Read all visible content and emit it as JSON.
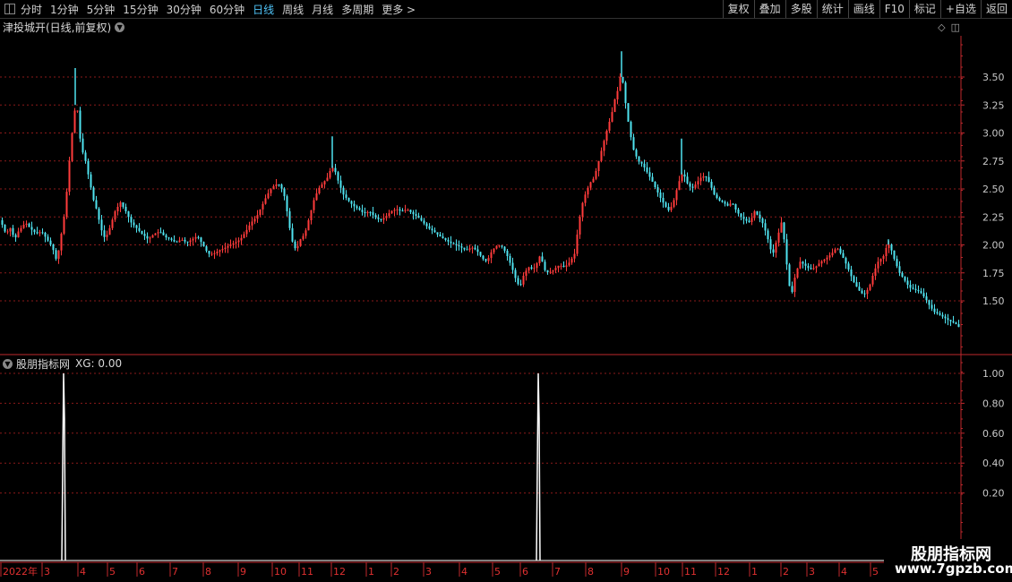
{
  "toolbar": {
    "periods": [
      {
        "label": "分时",
        "active": false
      },
      {
        "label": "1分钟",
        "active": false
      },
      {
        "label": "5分钟",
        "active": false
      },
      {
        "label": "15分钟",
        "active": false
      },
      {
        "label": "30分钟",
        "active": false
      },
      {
        "label": "60分钟",
        "active": false
      },
      {
        "label": "日线",
        "active": true
      },
      {
        "label": "周线",
        "active": false
      },
      {
        "label": "月线",
        "active": false
      },
      {
        "label": "多周期",
        "active": false
      },
      {
        "label": "更多 >",
        "active": false
      }
    ],
    "actions": [
      "复权",
      "叠加",
      "多股",
      "统计",
      "画线",
      "F10",
      "标记",
      "+自选",
      "返回"
    ]
  },
  "main_panel": {
    "title": "津投城开(日线,前复权)"
  },
  "indicator_panel": {
    "title": "股朋指标网",
    "value_label": "XG: 0.00"
  },
  "watermark": {
    "line1": "股朋指标网",
    "line2": "www.7gpzb.com"
  },
  "colors": {
    "up": "#ff3b3b",
    "down": "#4fe3f0",
    "axis": "#c0272d",
    "grid": "#8b1a1a",
    "signal": "#ffffff"
  },
  "chart_data": [
    {
      "type": "candlestick",
      "y_ticks": [
        "3.50",
        "3.25",
        "3.00",
        "2.75",
        "2.50",
        "2.25",
        "2.00",
        "1.75",
        "1.50"
      ],
      "ylim": [
        1.25,
        3.75
      ],
      "x_labels": [
        "2022年",
        "3",
        "4",
        "5",
        "6",
        "7",
        "8",
        "9",
        "10",
        "11",
        "12",
        "1",
        "2",
        "3",
        "4",
        "5",
        "6",
        "7",
        "8",
        "9",
        "10",
        "11",
        "12",
        "1",
        "2",
        "3",
        "4",
        "5"
      ],
      "close_path": [
        [
          0,
          2.22
        ],
        [
          6,
          2.1
        ],
        [
          11,
          2.15
        ],
        [
          16,
          2.05
        ],
        [
          20,
          2.12
        ],
        [
          28,
          2.2
        ],
        [
          33,
          2.15
        ],
        [
          40,
          2.1
        ],
        [
          46,
          2.12
        ],
        [
          52,
          2.05
        ],
        [
          58,
          1.98
        ],
        [
          63,
          1.85
        ],
        [
          67,
          2.05
        ],
        [
          71,
          2.25
        ],
        [
          75,
          2.55
        ],
        [
          78,
          2.85
        ],
        [
          82,
          3.15
        ],
        [
          85,
          3.3
        ],
        [
          88,
          3.0
        ],
        [
          91,
          2.85
        ],
        [
          95,
          2.75
        ],
        [
          100,
          2.55
        ],
        [
          104,
          2.4
        ],
        [
          108,
          2.3
        ],
        [
          112,
          2.15
        ],
        [
          117,
          2.05
        ],
        [
          122,
          2.15
        ],
        [
          128,
          2.3
        ],
        [
          134,
          2.38
        ],
        [
          140,
          2.3
        ],
        [
          146,
          2.2
        ],
        [
          152,
          2.15
        ],
        [
          158,
          2.1
        ],
        [
          165,
          2.05
        ],
        [
          172,
          2.1
        ],
        [
          178,
          2.12
        ],
        [
          184,
          2.07
        ],
        [
          190,
          2.05
        ],
        [
          196,
          2.02
        ],
        [
          202,
          2.05
        ],
        [
          208,
          2.02
        ],
        [
          214,
          2.05
        ],
        [
          220,
          2.08
        ],
        [
          226,
          2.0
        ],
        [
          232,
          1.92
        ],
        [
          238,
          1.92
        ],
        [
          244,
          1.95
        ],
        [
          250,
          1.97
        ],
        [
          256,
          2.0
        ],
        [
          262,
          2.02
        ],
        [
          268,
          2.05
        ],
        [
          274,
          2.12
        ],
        [
          280,
          2.2
        ],
        [
          286,
          2.25
        ],
        [
          292,
          2.35
        ],
        [
          298,
          2.45
        ],
        [
          304,
          2.52
        ],
        [
          310,
          2.55
        ],
        [
          316,
          2.48
        ],
        [
          320,
          2.3
        ],
        [
          325,
          2.05
        ],
        [
          330,
          1.95
        ],
        [
          335,
          2.05
        ],
        [
          340,
          2.1
        ],
        [
          345,
          2.25
        ],
        [
          350,
          2.4
        ],
        [
          355,
          2.5
        ],
        [
          360,
          2.55
        ],
        [
          365,
          2.6
        ],
        [
          370,
          2.7
        ],
        [
          374,
          2.65
        ],
        [
          378,
          2.55
        ],
        [
          383,
          2.45
        ],
        [
          388,
          2.4
        ],
        [
          394,
          2.35
        ],
        [
          400,
          2.32
        ],
        [
          406,
          2.28
        ],
        [
          412,
          2.3
        ],
        [
          418,
          2.25
        ],
        [
          424,
          2.22
        ],
        [
          430,
          2.25
        ],
        [
          436,
          2.3
        ],
        [
          442,
          2.32
        ],
        [
          448,
          2.3
        ],
        [
          454,
          2.32
        ],
        [
          460,
          2.28
        ],
        [
          466,
          2.25
        ],
        [
          472,
          2.2
        ],
        [
          478,
          2.15
        ],
        [
          484,
          2.12
        ],
        [
          490,
          2.08
        ],
        [
          496,
          2.05
        ],
        [
          502,
          2.02
        ],
        [
          508,
          2.0
        ],
        [
          514,
          1.98
        ],
        [
          520,
          1.95
        ],
        [
          526,
          1.98
        ],
        [
          532,
          1.95
        ],
        [
          538,
          1.88
        ],
        [
          543,
          1.85
        ],
        [
          549,
          1.95
        ],
        [
          555,
          2.0
        ],
        [
          561,
          1.98
        ],
        [
          566,
          1.9
        ],
        [
          571,
          1.8
        ],
        [
          576,
          1.68
        ],
        [
          580,
          1.62
        ],
        [
          585,
          1.75
        ],
        [
          590,
          1.8
        ],
        [
          595,
          1.78
        ],
        [
          600,
          1.85
        ],
        [
          603,
          1.92
        ],
        [
          607,
          1.78
        ],
        [
          612,
          1.75
        ],
        [
          618,
          1.78
        ],
        [
          624,
          1.82
        ],
        [
          630,
          1.8
        ],
        [
          636,
          1.85
        ],
        [
          641,
          1.92
        ],
        [
          645,
          2.15
        ],
        [
          649,
          2.35
        ],
        [
          653,
          2.45
        ],
        [
          658,
          2.55
        ],
        [
          663,
          2.6
        ],
        [
          668,
          2.75
        ],
        [
          673,
          2.9
        ],
        [
          678,
          3.05
        ],
        [
          682,
          3.15
        ],
        [
          686,
          3.3
        ],
        [
          690,
          3.4
        ],
        [
          693,
          3.55
        ],
        [
          696,
          3.4
        ],
        [
          699,
          3.2
        ],
        [
          703,
          3.0
        ],
        [
          707,
          2.85
        ],
        [
          712,
          2.75
        ],
        [
          717,
          2.72
        ],
        [
          722,
          2.65
        ],
        [
          727,
          2.58
        ],
        [
          732,
          2.5
        ],
        [
          737,
          2.42
        ],
        [
          742,
          2.35
        ],
        [
          747,
          2.3
        ],
        [
          752,
          2.4
        ],
        [
          757,
          2.55
        ],
        [
          762,
          2.65
        ],
        [
          767,
          2.55
        ],
        [
          772,
          2.5
        ],
        [
          777,
          2.55
        ],
        [
          782,
          2.6
        ],
        [
          787,
          2.62
        ],
        [
          792,
          2.55
        ],
        [
          797,
          2.45
        ],
        [
          802,
          2.4
        ],
        [
          807,
          2.38
        ],
        [
          812,
          2.35
        ],
        [
          817,
          2.38
        ],
        [
          822,
          2.3
        ],
        [
          827,
          2.25
        ],
        [
          832,
          2.22
        ],
        [
          837,
          2.2
        ],
        [
          842,
          2.3
        ],
        [
          847,
          2.25
        ],
        [
          852,
          2.18
        ],
        [
          857,
          2.05
        ],
        [
          862,
          1.9
        ],
        [
          867,
          2.05
        ],
        [
          872,
          2.2
        ],
        [
          876,
          2.0
        ],
        [
          880,
          1.65
        ],
        [
          884,
          1.58
        ],
        [
          888,
          1.75
        ],
        [
          893,
          1.85
        ],
        [
          898,
          1.82
        ],
        [
          904,
          1.78
        ],
        [
          910,
          1.8
        ],
        [
          916,
          1.85
        ],
        [
          922,
          1.88
        ],
        [
          928,
          1.92
        ],
        [
          934,
          1.98
        ],
        [
          940,
          1.9
        ],
        [
          946,
          1.8
        ],
        [
          952,
          1.68
        ],
        [
          958,
          1.6
        ],
        [
          964,
          1.55
        ],
        [
          970,
          1.62
        ],
        [
          975,
          1.75
        ],
        [
          980,
          1.85
        ],
        [
          986,
          1.9
        ],
        [
          991,
          2.02
        ],
        [
          995,
          1.95
        ],
        [
          999,
          1.85
        ],
        [
          1004,
          1.75
        ],
        [
          1010,
          1.68
        ],
        [
          1015,
          1.62
        ],
        [
          1021,
          1.6
        ],
        [
          1027,
          1.58
        ],
        [
          1033,
          1.52
        ],
        [
          1038,
          1.45
        ],
        [
          1043,
          1.4
        ],
        [
          1048,
          1.38
        ],
        [
          1054,
          1.35
        ],
        [
          1060,
          1.32
        ],
        [
          1066,
          1.3
        ],
        [
          1072,
          1.25
        ]
      ],
      "spikes": [
        [
          84,
          3.58
        ],
        [
          371,
          2.97
        ],
        [
          694,
          3.73
        ],
        [
          761,
          2.95
        ],
        [
          992,
          2.05
        ]
      ]
    },
    {
      "type": "line",
      "title": "XG",
      "y_ticks": [
        "1.00",
        "0.80",
        "0.60",
        "0.40",
        "0.20"
      ],
      "ylim": [
        0,
        1.05
      ],
      "signals": [
        71,
        601
      ],
      "value": 0.0
    }
  ]
}
